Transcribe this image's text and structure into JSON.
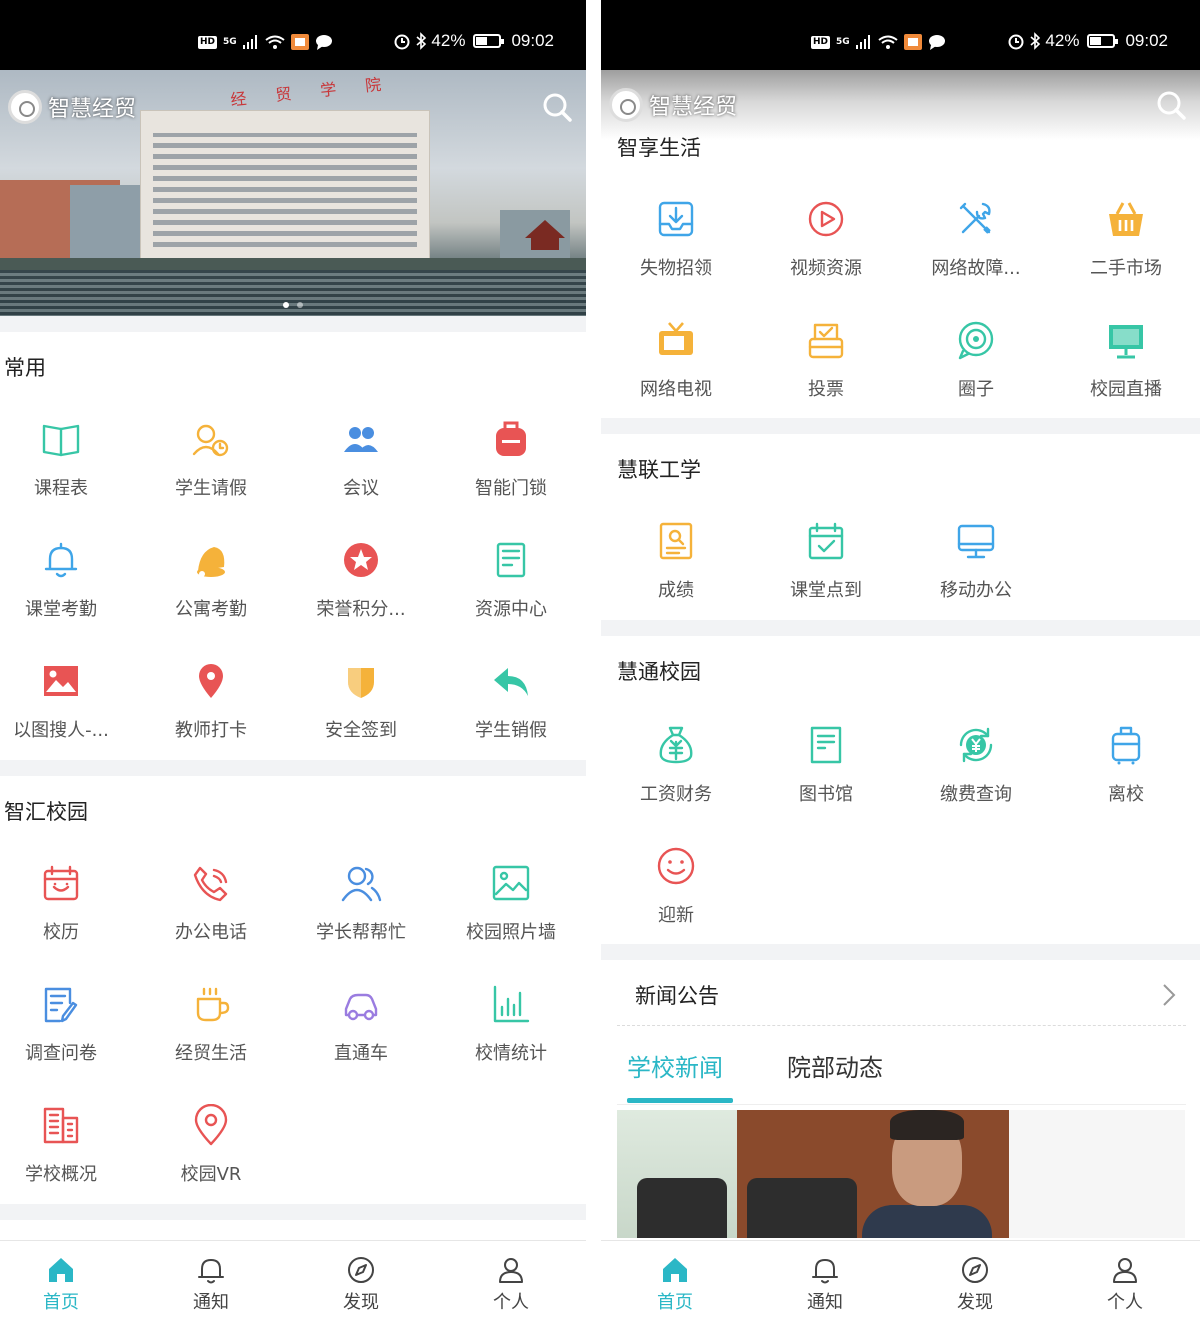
{
  "status_bar": {
    "network": "5G",
    "hd": "HD",
    "battery": "42%",
    "battery_level": 0.42,
    "time": "09:02"
  },
  "app": {
    "name": "智慧经贸",
    "banner_sign": "经 贸 学 院"
  },
  "left": {
    "sections": {
      "common": {
        "title": "常用",
        "items": [
          {
            "label": "课程表",
            "icon": "book-icon",
            "color": "#37c6a6"
          },
          {
            "label": "学生请假",
            "icon": "person-clock-icon",
            "color": "#f5b23a"
          },
          {
            "label": "会议",
            "icon": "people-icon",
            "color": "#4a8ee0"
          },
          {
            "label": "智能门锁",
            "icon": "backpack-icon",
            "color": "#e85454"
          },
          {
            "label": "课堂考勤",
            "icon": "bell-icon",
            "color": "#3fa5e8"
          },
          {
            "label": "公寓考勤",
            "icon": "bell-filled-icon",
            "color": "#f5b23a"
          },
          {
            "label": "荣誉积分...",
            "icon": "star-badge-icon",
            "color": "#e85454"
          },
          {
            "label": "资源中心",
            "icon": "document-icon",
            "color": "#37c6a6"
          },
          {
            "label": "以图搜人-...",
            "icon": "image-icon",
            "color": "#e85454"
          },
          {
            "label": "教师打卡",
            "icon": "location-pin-icon",
            "color": "#e85454"
          },
          {
            "label": "安全签到",
            "icon": "shield-icon",
            "color": "#f5b23a"
          },
          {
            "label": "学生销假",
            "icon": "reply-arrow-icon",
            "color": "#37c6a6"
          }
        ]
      },
      "campus": {
        "title": "智汇校园",
        "items": [
          {
            "label": "校历",
            "icon": "calendar-icon",
            "color": "#e85454"
          },
          {
            "label": "办公电话",
            "icon": "phone-icon",
            "color": "#e85454"
          },
          {
            "label": "学长帮帮忙",
            "icon": "users-icon",
            "color": "#4a8ee0"
          },
          {
            "label": "校园照片墙",
            "icon": "photo-icon",
            "color": "#37c6a6"
          },
          {
            "label": "调查问卷",
            "icon": "survey-icon",
            "color": "#4a8ee0"
          },
          {
            "label": "经贸生活",
            "icon": "coffee-icon",
            "color": "#f5b23a"
          },
          {
            "label": "直通车",
            "icon": "car-icon",
            "color": "#9a7ce0"
          },
          {
            "label": "校情统计",
            "icon": "bar-chart-icon",
            "color": "#37c6a6"
          },
          {
            "label": "学校概况",
            "icon": "building-icon",
            "color": "#e85454"
          },
          {
            "label": "校园VR",
            "icon": "map-pin-icon",
            "color": "#e85454"
          }
        ]
      }
    }
  },
  "right": {
    "sections": {
      "life": {
        "title": "智享生活",
        "items": [
          {
            "label": "失物招领",
            "icon": "inbox-icon",
            "color": "#3fa5e8"
          },
          {
            "label": "视频资源",
            "icon": "play-circle-icon",
            "color": "#e85454"
          },
          {
            "label": "网络故障...",
            "icon": "tools-icon",
            "color": "#3fa5e8"
          },
          {
            "label": "二手市场",
            "icon": "basket-icon",
            "color": "#f5b23a"
          },
          {
            "label": "网络电视",
            "icon": "tv-icon",
            "color": "#f5b23a"
          },
          {
            "label": "投票",
            "icon": "ballot-icon",
            "color": "#f5b23a"
          },
          {
            "label": "圈子",
            "icon": "chat-circle-icon",
            "color": "#37c6a6"
          },
          {
            "label": "校园直播",
            "icon": "monitor-icon",
            "color": "#37c6a6"
          }
        ]
      },
      "work": {
        "title": "慧联工学",
        "items": [
          {
            "label": "成绩",
            "icon": "report-icon",
            "color": "#f5b23a"
          },
          {
            "label": "课堂点到",
            "icon": "calendar-check-icon",
            "color": "#37c6a6"
          },
          {
            "label": "移动办公",
            "icon": "desktop-icon",
            "color": "#3fa5e8"
          }
        ]
      },
      "connect": {
        "title": "慧通校园",
        "items": [
          {
            "label": "工资财务",
            "icon": "money-bag-icon",
            "color": "#37c6a6"
          },
          {
            "label": "图书馆",
            "icon": "library-icon",
            "color": "#37c6a6"
          },
          {
            "label": "缴费查询",
            "icon": "yuan-refresh-icon",
            "color": "#37c6a6"
          },
          {
            "label": "离校",
            "icon": "luggage-icon",
            "color": "#3fa5e8"
          },
          {
            "label": "迎新",
            "icon": "smile-icon",
            "color": "#e85454"
          }
        ]
      }
    },
    "news": {
      "title": "新闻公告",
      "tabs": [
        "学校新闻",
        "院部动态"
      ],
      "active_tab": "学校新闻"
    }
  },
  "tabbar": {
    "items": [
      {
        "label": "首页",
        "icon": "home-icon",
        "active": true
      },
      {
        "label": "通知",
        "icon": "bell-outline-icon",
        "active": false
      },
      {
        "label": "发现",
        "icon": "compass-icon",
        "active": false
      },
      {
        "label": "个人",
        "icon": "user-icon",
        "active": false
      }
    ],
    "accent": "#2bb7c6"
  }
}
